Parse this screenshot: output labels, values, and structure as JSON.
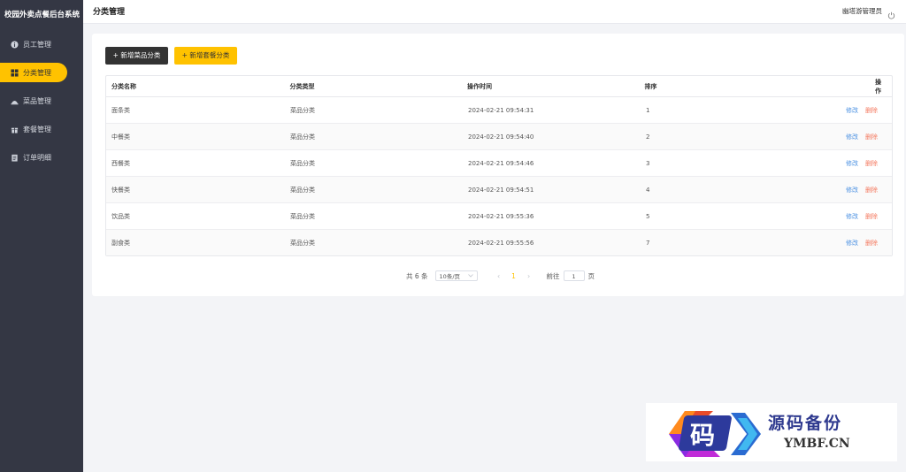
{
  "app": {
    "title": "校园外卖点餐后台系统"
  },
  "sidebar": {
    "items": [
      {
        "label": "员工管理",
        "icon": "info-circle-icon"
      },
      {
        "label": "分类管理",
        "icon": "grid-icon",
        "active": true
      },
      {
        "label": "菜品管理",
        "icon": "dish-icon"
      },
      {
        "label": "套餐管理",
        "icon": "gift-box-icon"
      },
      {
        "label": "订单明细",
        "icon": "clipboard-icon"
      }
    ]
  },
  "header": {
    "title": "分类管理",
    "user": "幽塔游管理员",
    "logout_icon": "power-icon"
  },
  "toolbar": {
    "add_dish_category": "+ 新增菜品分类",
    "add_setmeal_category": "+ 新增套餐分类"
  },
  "table": {
    "columns": [
      "分类名称",
      "分类类型",
      "操作时间",
      "排序",
      "操作"
    ],
    "rows": [
      {
        "name": "面条类",
        "type": "菜品分类",
        "time": "2024-02-21 09:54:31",
        "sort": "1",
        "edit": "修改",
        "delete": "删除"
      },
      {
        "name": "中餐类",
        "type": "菜品分类",
        "time": "2024-02-21 09:54:40",
        "sort": "2",
        "edit": "修改",
        "delete": "删除"
      },
      {
        "name": "西餐类",
        "type": "菜品分类",
        "time": "2024-02-21 09:54:46",
        "sort": "3",
        "edit": "修改",
        "delete": "删除"
      },
      {
        "name": "快餐类",
        "type": "菜品分类",
        "time": "2024-02-21 09:54:51",
        "sort": "4",
        "edit": "修改",
        "delete": "删除"
      },
      {
        "name": "饮品类",
        "type": "菜品分类",
        "time": "2024-02-21 09:55:36",
        "sort": "5",
        "edit": "修改",
        "delete": "删除"
      },
      {
        "name": "副食类",
        "type": "菜品分类",
        "time": "2024-02-21 09:55:56",
        "sort": "7",
        "edit": "修改",
        "delete": "删除"
      }
    ]
  },
  "pagination": {
    "total": "共 6 条",
    "page_size": "10条/页",
    "prev": "‹",
    "current": "1",
    "next": "›",
    "goto_label": "前往",
    "goto_value": "1",
    "page_suffix": "页"
  },
  "watermark": {
    "mark": "码",
    "title": "源码备份",
    "url": "YMBF.CN"
  },
  "colors": {
    "accent": "#ffc200",
    "sidebar": "#343744",
    "edit": "#4a90e2",
    "delete": "#f4795f"
  }
}
